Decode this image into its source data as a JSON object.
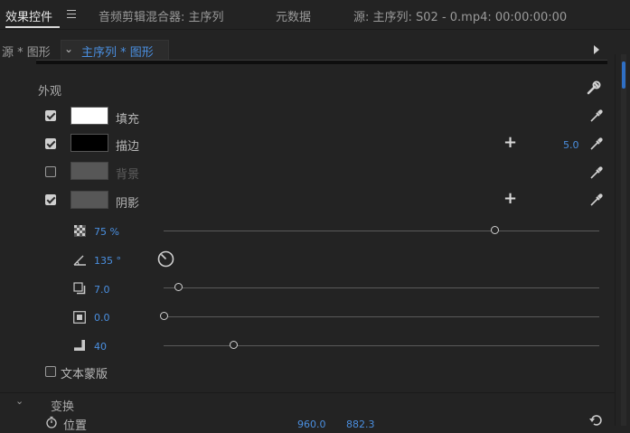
{
  "tabs": [
    {
      "label": "效果控件",
      "active": true
    },
    {
      "label": "音频剪辑混合器: 主序列",
      "active": false
    },
    {
      "label": "元数据",
      "active": false
    },
    {
      "label": "源: 主序列: S02 - 0.mp4: 00:00:00:00",
      "active": false
    }
  ],
  "source_row": {
    "source_label": "源 * 图形",
    "sequence_label": "主序列 * 图形"
  },
  "appearance": {
    "title": "外观",
    "fill": {
      "label": "填充",
      "checked": true,
      "color": "#ffffff"
    },
    "stroke": {
      "label": "描边",
      "checked": true,
      "color": "#000000",
      "width": "5.0"
    },
    "background": {
      "label": "背景",
      "checked": false,
      "color": "#575757"
    },
    "shadow": {
      "label": "阴影",
      "checked": true,
      "color": "#575757"
    },
    "shadow_props": {
      "opacity": {
        "value": "75",
        "unit": "%",
        "fraction": 0.76
      },
      "angle": {
        "value": "135",
        "unit": "°"
      },
      "distance": {
        "value": "7.0",
        "fraction": 0.035
      },
      "size": {
        "value": "0.0",
        "fraction": 0.0
      },
      "blur": {
        "value": "40",
        "fraction": 0.16
      }
    },
    "text_mask": {
      "label": "文本蒙版",
      "checked": false
    }
  },
  "transform": {
    "title": "变换",
    "position": {
      "label": "位置",
      "x": "960.0",
      "y": "882.3"
    }
  },
  "colors": {
    "accent": "#4a8fe0"
  }
}
